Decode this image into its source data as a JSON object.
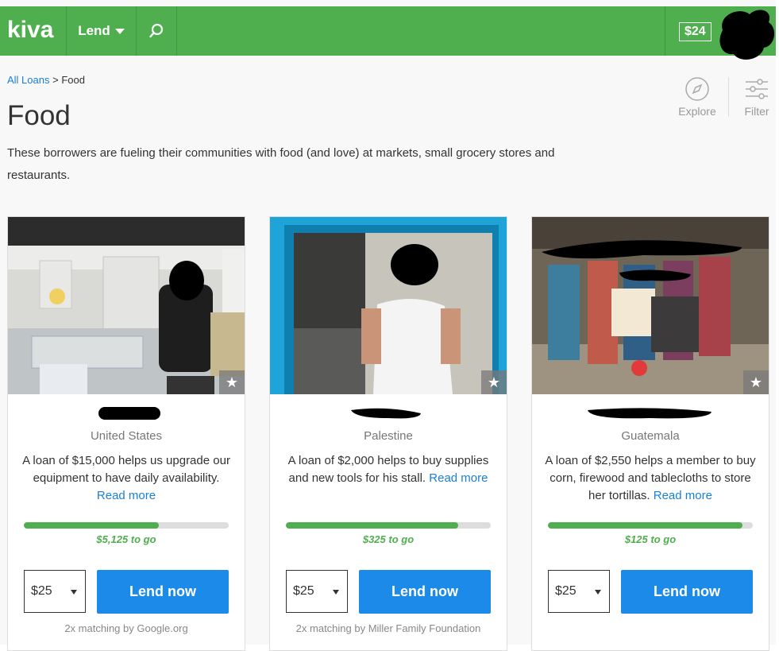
{
  "header": {
    "logo": "kiva",
    "lend_label": "Lend",
    "balance": "$24"
  },
  "breadcrumb": {
    "root": "All Loans",
    "separator": ">",
    "current": "Food"
  },
  "page": {
    "title": "Food",
    "description": "These borrowers are fueling their communities with food (and love) at markets, small grocery stores and restaurants."
  },
  "tools": {
    "explore_label": "Explore",
    "filter_label": "Filter"
  },
  "colors": {
    "brand_green": "#4faf4e",
    "link_blue": "#1a7fd6",
    "button_blue": "#1c8ae8"
  },
  "cards": [
    {
      "country": "United States",
      "description": "A loan of $15,000 helps us upgrade our equipment to have daily availability.",
      "read_more": "Read more",
      "funded_fraction": 0.66,
      "to_go": "$5,125 to go",
      "amount": "$25",
      "lend_label": "Lend now",
      "matching": "2x matching by Google.org"
    },
    {
      "country": "Palestine",
      "description": "A loan of $2,000 helps to buy supplies and new tools for his stall.",
      "read_more": "Read more",
      "funded_fraction": 0.84,
      "to_go": "$325 to go",
      "amount": "$25",
      "lend_label": "Lend now",
      "matching": "2x matching by Miller Family Foundation"
    },
    {
      "country": "Guatemala",
      "description": "A loan of $2,550 helps a member to buy corn, firewood and tablecloths to store her tortillas.",
      "read_more": "Read more",
      "funded_fraction": 0.95,
      "to_go": "$125 to go",
      "amount": "$25",
      "lend_label": "Lend now",
      "matching": ""
    }
  ]
}
